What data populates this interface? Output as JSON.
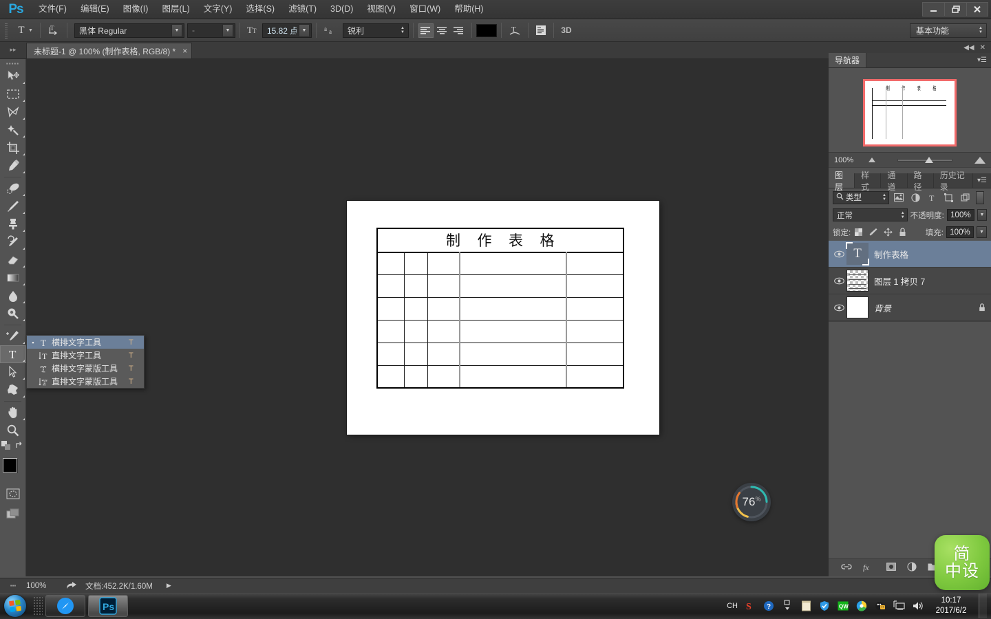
{
  "app": {
    "logo": "Ps",
    "title": "Adobe Photoshop"
  },
  "menubar": {
    "items": [
      {
        "label": "文件(F)"
      },
      {
        "label": "编辑(E)"
      },
      {
        "label": "图像(I)"
      },
      {
        "label": "图层(L)"
      },
      {
        "label": "文字(Y)"
      },
      {
        "label": "选择(S)"
      },
      {
        "label": "滤镜(T)"
      },
      {
        "label": "3D(D)"
      },
      {
        "label": "视图(V)"
      },
      {
        "label": "窗口(W)"
      },
      {
        "label": "帮助(H)"
      }
    ]
  },
  "window_controls": {
    "minimize": "minimize-icon",
    "restore": "restore-icon",
    "close": "close-icon"
  },
  "options_bar": {
    "tool_preset": "T",
    "orientation_label": "切换文本取向",
    "font_family": "黑体 Regular",
    "font_style": "-",
    "font_size": "15.82 点",
    "antialias_label": "aa",
    "antialias": "锐利",
    "align_left": "左对齐文本",
    "align_center": "居中对齐文本",
    "align_right": "右对齐文本",
    "color": "#000000",
    "warp_label": "创建文字变形",
    "panels_label": "切换字符和段落面板",
    "threed_label": "3D",
    "workspace": "基本功能"
  },
  "tab": {
    "title": "未标题-1 @ 100% (制作表格, RGB/8) *",
    "close": "×"
  },
  "toolbox": {
    "tools": [
      {
        "name": "move-tool"
      },
      {
        "name": "marquee-tool"
      },
      {
        "name": "lasso-tool"
      },
      {
        "name": "magic-wand-tool"
      },
      {
        "name": "crop-tool"
      },
      {
        "name": "eyedropper-tool"
      },
      {
        "name": "healing-brush-tool"
      },
      {
        "name": "brush-tool"
      },
      {
        "name": "clone-stamp-tool"
      },
      {
        "name": "history-brush-tool"
      },
      {
        "name": "eraser-tool"
      },
      {
        "name": "gradient-tool"
      },
      {
        "name": "blur-tool"
      },
      {
        "name": "dodge-tool"
      },
      {
        "name": "pen-tool"
      },
      {
        "name": "type-tool"
      },
      {
        "name": "path-selection-tool"
      },
      {
        "name": "shape-tool"
      },
      {
        "name": "hand-tool"
      },
      {
        "name": "zoom-tool"
      }
    ],
    "foreground_color": "#000000",
    "background_color": "#fae6ee"
  },
  "tool_flyout": {
    "items": [
      {
        "label": "横排文字工具",
        "shortcut": "T",
        "selected": true
      },
      {
        "label": "直排文字工具",
        "shortcut": "T",
        "selected": false
      },
      {
        "label": "横排文字蒙版工具",
        "shortcut": "T",
        "selected": false
      },
      {
        "label": "直排文字蒙版工具",
        "shortcut": "T",
        "selected": false
      }
    ]
  },
  "canvas": {
    "table": {
      "title": "制　作　表　格",
      "title_chars": [
        "制",
        "作",
        "表",
        "格"
      ],
      "columns": 5,
      "body_rows": 6,
      "cells": [
        [
          "",
          "",
          "",
          "",
          ""
        ],
        [
          "",
          "",
          "",
          "",
          ""
        ],
        [
          "",
          "",
          "",
          "",
          ""
        ],
        [
          "",
          "",
          "",
          "",
          ""
        ],
        [
          "",
          "",
          "",
          "",
          ""
        ],
        [
          "",
          "",
          "",
          "",
          ""
        ]
      ]
    }
  },
  "navigator": {
    "tab_label": "导航器",
    "zoom": "100%",
    "thumb_chars": [
      "制",
      "作",
      "表",
      "格"
    ]
  },
  "layers_panel": {
    "tabs": [
      {
        "label": "图层",
        "active": true
      },
      {
        "label": "样式",
        "active": false
      },
      {
        "label": "通道",
        "active": false
      },
      {
        "label": "路径",
        "active": false
      },
      {
        "label": "历史记录",
        "active": false
      }
    ],
    "filter_type": "类型",
    "filter_icons": [
      "pixel-filter-icon",
      "adjustment-filter-icon",
      "type-filter-icon",
      "shape-filter-icon",
      "smart-object-filter-icon"
    ],
    "blend_mode": "正常",
    "opacity_label": "不透明度:",
    "opacity_value": "100%",
    "lock_label": "锁定:",
    "lock_icons": [
      "lock-transparent-icon",
      "lock-image-icon",
      "lock-position-icon",
      "lock-all-icon"
    ],
    "fill_label": "填充:",
    "fill_value": "100%",
    "layers": [
      {
        "name": "制作表格",
        "type": "text",
        "visible": true,
        "selected": true,
        "locked": false,
        "italic": false
      },
      {
        "name": "图层 1 拷贝 7",
        "type": "pixel",
        "visible": true,
        "selected": false,
        "locked": false,
        "italic": false
      },
      {
        "name": "背景",
        "type": "background",
        "visible": true,
        "selected": false,
        "locked": true,
        "italic": true
      }
    ],
    "footer_buttons": [
      "link-layers-icon",
      "layer-style-icon",
      "layer-mask-icon",
      "adjustment-layer-icon",
      "new-group-icon",
      "new-layer-icon",
      "delete-layer-icon"
    ]
  },
  "status_bar": {
    "zoom": "100%",
    "share_icon": "share-icon",
    "doc_info": "文档:452.2K/1.60M",
    "expand_arrow": "▶"
  },
  "widgets": {
    "gauge_value": "76",
    "gauge_unit": "%",
    "logo_line1": "简",
    "logo_line2": "中设"
  },
  "taskbar": {
    "start": "windows-start-orb",
    "buttons": [
      {
        "name": "browser-taskbar-button",
        "label": ""
      },
      {
        "name": "photoshop-taskbar-button",
        "label": "Ps",
        "active": true
      }
    ],
    "tray": {
      "ime": "CH",
      "icons": [
        "sogou-icon",
        "help-icon",
        "network-icon",
        "notepad-icon",
        "shield-icon",
        "qq-music-icon",
        "browser-icon",
        "qq-icon",
        "monitor-icon",
        "volume-icon"
      ]
    },
    "clock_time": "10:17",
    "clock_date": "2017/6/2"
  },
  "colors": {
    "accent_selection": "#6b7f99",
    "panel_bg": "#535353",
    "canvas_bg": "#2f2f2f",
    "nav_frame": "#f26a6a",
    "brand_blue": "#2aa8e0"
  }
}
